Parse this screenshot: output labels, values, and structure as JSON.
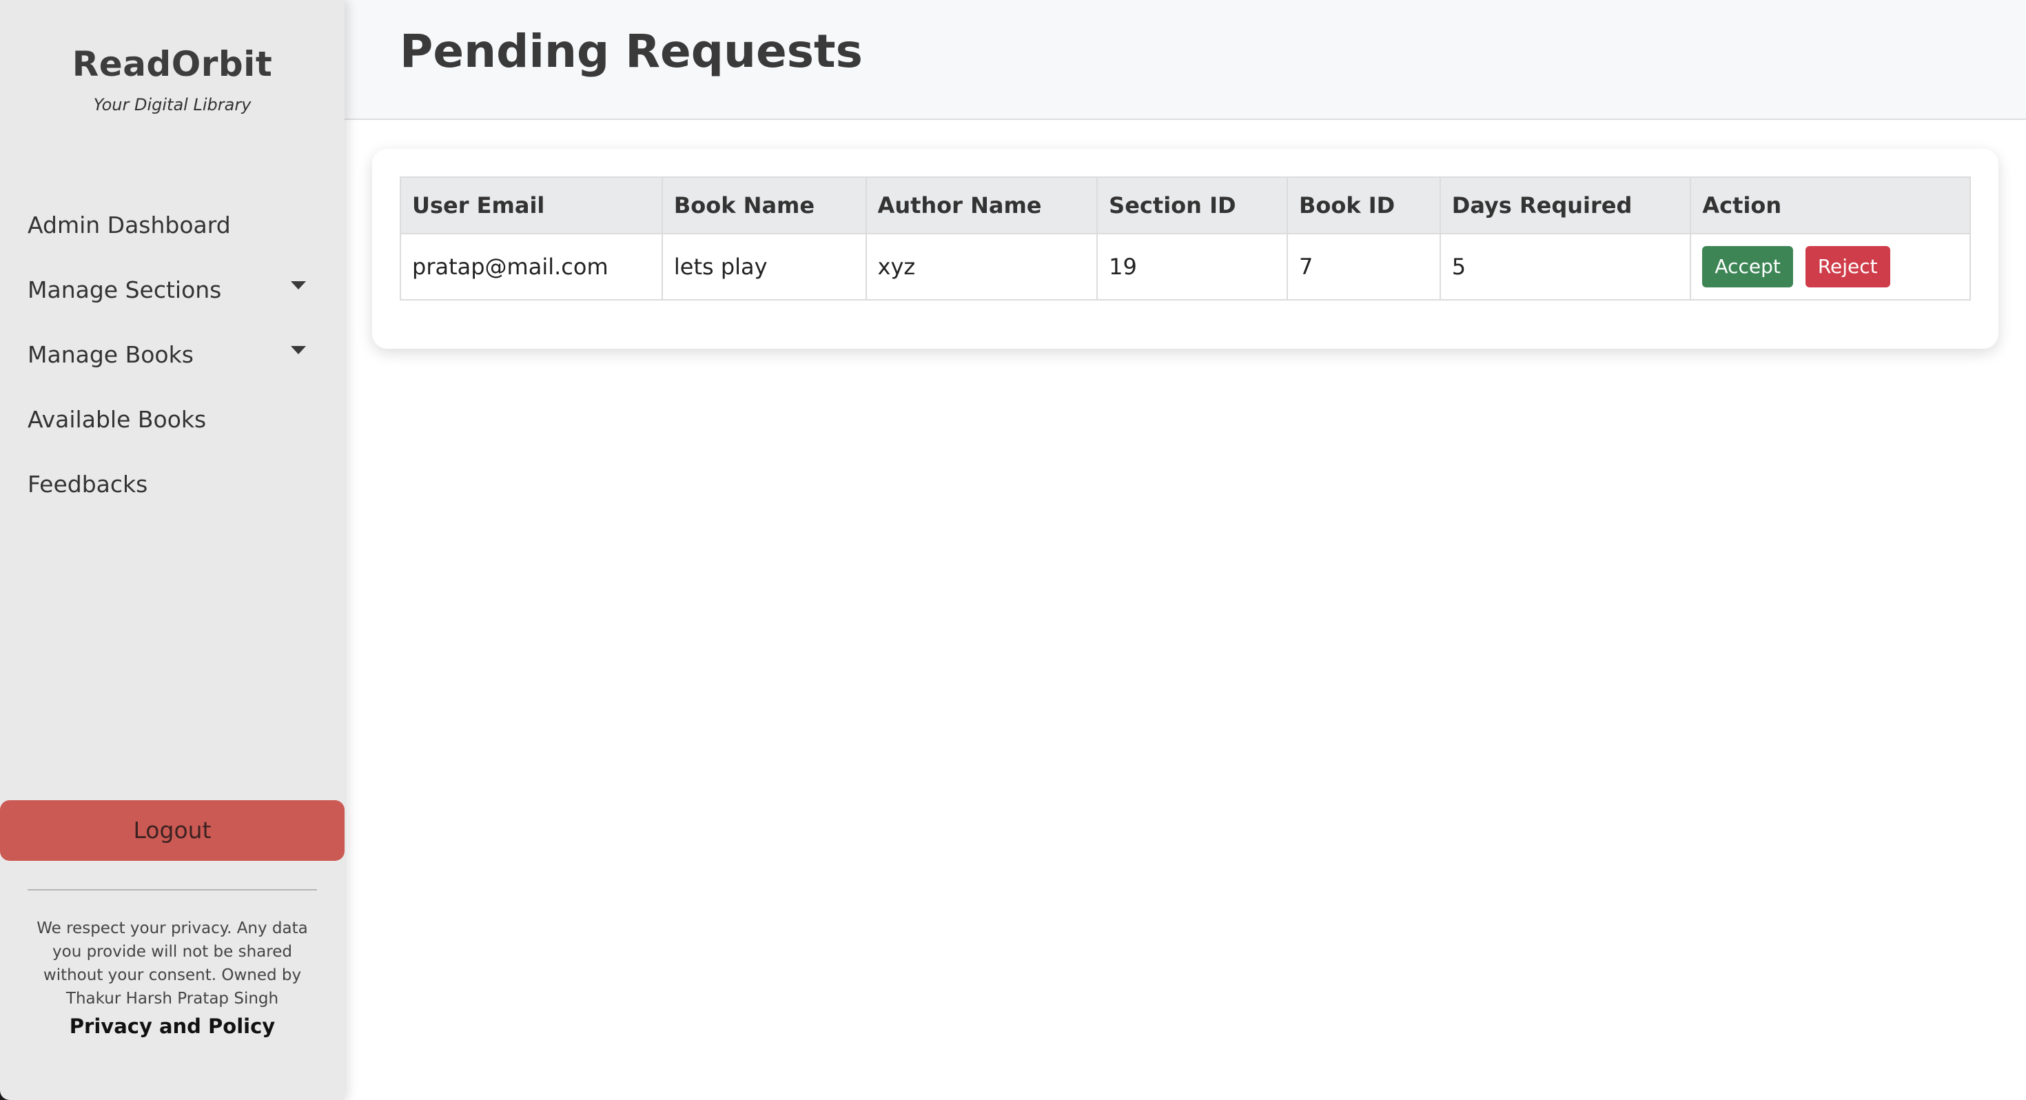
{
  "sidebar": {
    "brand_title": "ReadOrbit",
    "brand_subtitle": "Your Digital Library",
    "items": [
      {
        "label": "Admin Dashboard",
        "has_dropdown": false
      },
      {
        "label": "Manage Sections",
        "has_dropdown": true
      },
      {
        "label": "Manage Books",
        "has_dropdown": true
      },
      {
        "label": "Available Books",
        "has_dropdown": false
      },
      {
        "label": "Feedbacks",
        "has_dropdown": false
      }
    ],
    "logout_label": "Logout",
    "privacy_text": "We respect your privacy. Any data you provide will not be shared without your consent. Owned by Thakur Harsh Pratap Singh",
    "privacy_link": "Privacy and Policy"
  },
  "header": {
    "title": "Pending Requests"
  },
  "table": {
    "columns": [
      "User Email",
      "Book Name",
      "Author Name",
      "Section ID",
      "Book ID",
      "Days Required",
      "Action"
    ],
    "rows": [
      {
        "user_email": "pratap@mail.com",
        "book_name": "lets play",
        "author_name": "xyz",
        "section_id": "19",
        "book_id": "7",
        "days_required": "5",
        "accept_label": "Accept",
        "reject_label": "Reject"
      }
    ]
  },
  "colors": {
    "sidebar_bg": "#e9e9ea",
    "logout_bg": "#cb5a54",
    "accept": "#3e8556",
    "reject": "#cf3d4a"
  }
}
